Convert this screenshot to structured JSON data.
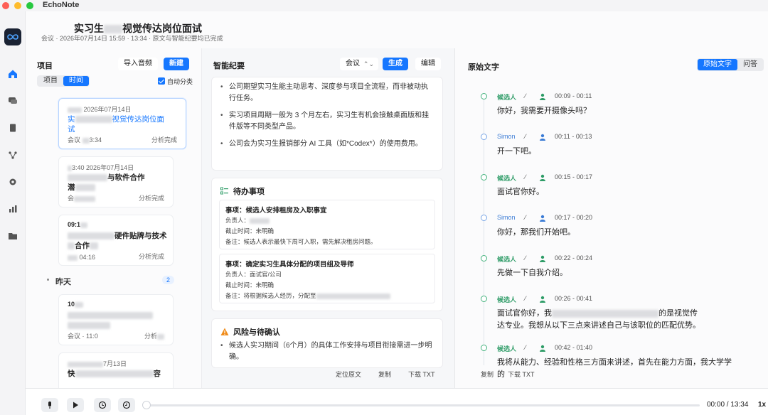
{
  "app": {
    "title": "EchoNote"
  },
  "header": {
    "title": "实习生",
    "title_suffix": "视觉传达岗位面试",
    "meta": "会议 · 2026年07月14日 15:59 · 13:34 · 原文与智能纪要均已完成"
  },
  "left": {
    "title": "项目",
    "import_label": "导入音频",
    "new_label": "新建",
    "tab_project": "项目",
    "tab_time": "时间",
    "auto_group_label": "自动分类",
    "cards": [
      {
        "time": "2026年07月14日",
        "title_a": "实",
        "title_b": "视觉传达岗位面",
        "title_c": "试",
        "foot": "会议",
        "foot_b": "3:34",
        "status": "分析完成"
      },
      {
        "time": "3:40",
        "time_b": "2026年07月14日",
        "title_a": "与软件合作",
        "title_b": "潜",
        "foot": "会",
        "status": "分析完成"
      },
      {
        "time": "09:1",
        "title_a": "硬件贴牌与技术",
        "title_b": "合作",
        "foot_b": "04:16",
        "status": "分析完成"
      },
      {
        "time": "10",
        "foot": "会议 · 11:0",
        "status": "分析"
      },
      {
        "time_b": "7月13日",
        "title_a": "快",
        "title_b": "容"
      }
    ],
    "group_label": "昨天",
    "group_count": "2"
  },
  "mid": {
    "title": "智能纪要",
    "select_value": "会议",
    "generate_label": "生成",
    "edit_label": "编辑",
    "bullets": [
      "公司期望实习生能主动思考、深度参与项目全流程，而非被动执行任务。",
      "实习项目周期一般为 3 个月左右，实习生有机会接触桌面版和挂件版等不同类型产品。",
      "公司会为实习生报销部分 AI 工具（如*Codex*）的使用费用。"
    ],
    "todo_title": "待办事项",
    "todos": [
      {
        "head": "事项：候选人安排租房及入职事宜",
        "owner": "负责人：",
        "due": "截止时间：未明确",
        "note": "备注：候选人表示最快下周可入职，需先解决租房问题。"
      },
      {
        "head": "事项：确定实习生具体分配的项目组及导师",
        "owner": "负责人：面试官/公司",
        "due": "截止时间：未明确",
        "note": "备注：将根据候选人经历，分配至"
      }
    ],
    "risk_title": "风险与待确认",
    "risks": [
      "候选人实习期间（6个月）的具体工作安排与项目衔接需进一步明确。"
    ],
    "locate_label": "定位原文",
    "copy_label": "复制",
    "download_label": "下载 TXT"
  },
  "right": {
    "title": "原始文字",
    "tab_original": "原始文字",
    "tab_qa": "问答",
    "segments": [
      {
        "speaker": "候选人",
        "edit": "∕",
        "time": "00:09 - 00:11",
        "text": "你好，我需要开摄像头吗？"
      },
      {
        "speaker": "Simon",
        "edit": "∕",
        "time": "00:11 - 00:13",
        "text": "开一下吧。"
      },
      {
        "speaker": "候选人",
        "edit": "∕",
        "time": "00:15 - 00:17",
        "text": "面试官你好。"
      },
      {
        "speaker": "Simon",
        "edit": "∕",
        "time": "00:17 - 00:20",
        "text": "你好，那我们开始吧。"
      },
      {
        "speaker": "候选人",
        "edit": "∕",
        "time": "00:22 - 00:24",
        "text": "先做一下自我介绍。"
      },
      {
        "speaker": "候选人",
        "edit": "∕",
        "time": "00:26 - 00:41",
        "text_a": "面试官你好，我",
        "text_b": "的是视觉传",
        "text_c": "达专业。我想从以下三点来讲述自己与该职位的匹配优势。"
      },
      {
        "speaker": "候选人",
        "edit": "∕",
        "time": "00:42 - 01:40",
        "text": "我将从能力、经验和性格三方面来讲述，首先在能力方面，我大学学的"
      }
    ],
    "copy_label": "复制",
    "download_label": "下载 TXT"
  },
  "player": {
    "time": "00:00 / 13:34",
    "speed": "1x",
    "progress": 0
  },
  "colors": {
    "accent": "#1677ff",
    "speaker_candidate": "#2e9c67",
    "speaker_simon": "#3a7bd5"
  }
}
